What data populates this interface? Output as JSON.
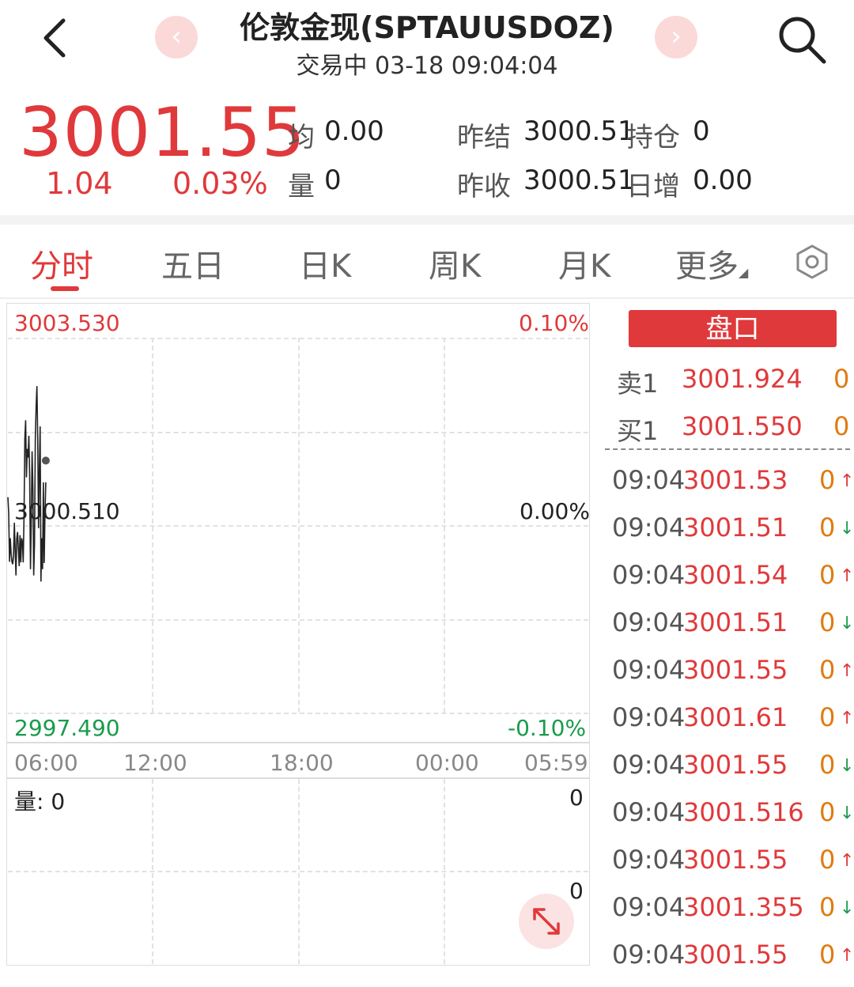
{
  "header": {
    "title": "伦敦金现(SPTAUUSDOZ)",
    "subtitle": "交易中 03-18 09:04:04",
    "prev_glyph": "‹",
    "next_glyph": "›",
    "back_icon": "back-chevron-icon",
    "search_icon": "search-icon"
  },
  "quote": {
    "price": "3001.55",
    "change": "1.04",
    "change_pct": "0.03%",
    "stats": {
      "avg_label": "均",
      "avg_value": "0.00",
      "vol_label": "量",
      "vol_value": "0",
      "prev_settle_label": "昨结",
      "prev_settle_value": "3000.51",
      "open_interest_label": "持仓",
      "open_interest_value": "0",
      "prev_close_label": "昨收",
      "prev_close_value": "3000.51",
      "daily_inc_label": "日增",
      "daily_inc_value": "0.00"
    }
  },
  "tabs": [
    {
      "label": "分时",
      "active": true
    },
    {
      "label": "五日"
    },
    {
      "label": "日K"
    },
    {
      "label": "周K"
    },
    {
      "label": "月K"
    },
    {
      "label": "更多"
    }
  ],
  "settings_icon": "gear-icon",
  "chart_data": {
    "type": "line",
    "ylim": [
      2997.49,
      3003.53
    ],
    "y_top_label": "3003.530",
    "y_top_pct": "0.10%",
    "y_mid_label": "3000.510",
    "y_mid_pct": "0.00%",
    "y_bottom_label": "2997.490",
    "y_bottom_pct": "-0.10%",
    "x_ticks": [
      "06:00",
      "12:00",
      "18:00",
      "00:00",
      "05:59"
    ],
    "values": [
      3000.96,
      3000.7,
      2999.92,
      3000.3,
      3000.05,
      2999.92,
      2999.88,
      3000.03,
      3000.55,
      3000.11,
      2999.7,
      3000.3,
      3000.4,
      3000.12,
      2999.85,
      3000.35,
      2999.91,
      3000.3,
      3000.25,
      2999.91,
      3000.66,
      3001.9,
      3002.2,
      3001.28,
      3001.74,
      3001.6,
      3001.95,
      3001.3,
      2999.8,
      3000.6,
      3001.7,
      3001.1,
      2999.7,
      3000.2,
      3001.9,
      3002.42,
      3002.75,
      3001.91,
      3000.46,
      3001.4,
      3002.1,
      2999.6,
      3000.3,
      2999.8,
      3001.2,
      2999.9,
      3000.7,
      3001.2
    ],
    "last_value": 3001.55,
    "volume_label": "量:",
    "volume_value": "0",
    "volume_axis_top": "0",
    "volume_axis_mid": "0"
  },
  "order_book": {
    "title": "盘口",
    "sell": {
      "label": "卖1",
      "price": "3001.924",
      "qty": "0"
    },
    "buy": {
      "label": "买1",
      "price": "3001.550",
      "qty": "0"
    }
  },
  "ticks": [
    {
      "time": "09:04",
      "price": "3001.53",
      "qty": "0",
      "dir": "up"
    },
    {
      "time": "09:04",
      "price": "3001.51",
      "qty": "0",
      "dir": "down"
    },
    {
      "time": "09:04",
      "price": "3001.54",
      "qty": "0",
      "dir": "up"
    },
    {
      "time": "09:04",
      "price": "3001.51",
      "qty": "0",
      "dir": "down"
    },
    {
      "time": "09:04",
      "price": "3001.55",
      "qty": "0",
      "dir": "up"
    },
    {
      "time": "09:04",
      "price": "3001.61",
      "qty": "0",
      "dir": "up"
    },
    {
      "time": "09:04",
      "price": "3001.55",
      "qty": "0",
      "dir": "down"
    },
    {
      "time": "09:04",
      "price": "3001.516",
      "qty": "0",
      "dir": "down"
    },
    {
      "time": "09:04",
      "price": "3001.55",
      "qty": "0",
      "dir": "up"
    },
    {
      "time": "09:04",
      "price": "3001.355",
      "qty": "0",
      "dir": "down"
    },
    {
      "time": "09:04",
      "price": "3001.55",
      "qty": "0",
      "dir": "up"
    }
  ],
  "colors": {
    "up": "#e0393b",
    "down": "#1a9b4c",
    "qty": "#e07b10"
  }
}
